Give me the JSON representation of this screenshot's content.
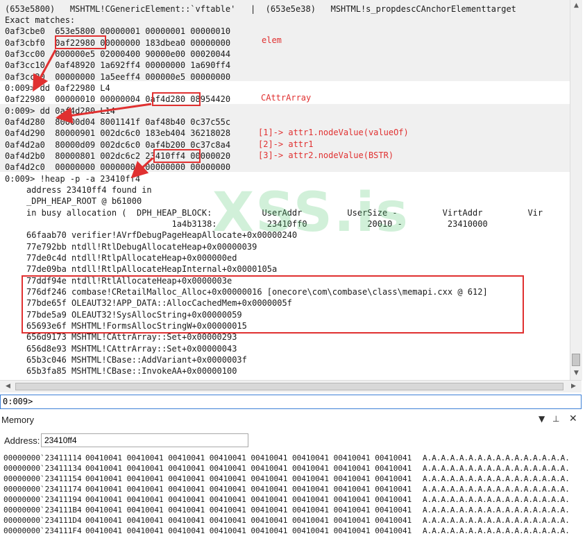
{
  "console": {
    "lines": [
      "(653e5800)   MSHTML!CGenericElement::`vftable'   |  (653e5e38)   MSHTML!s_propdescCAnchorElementtarget",
      "Exact matches:",
      "0af3cbe0  653e5800 00000001 00000001 00000010",
      "0af3cbf0  0af22980 00000000 183dbea0 00000000",
      "0af3cc00  000000e5 02000400 90000e00 00020044",
      "0af3cc10  0af48920 1a692ff4 00000000 1a690ff4",
      "0af3cc20  00000000 1a5eeff4 000000e5 00000000",
      "0:009> dd 0af22980 L4",
      "0af22980  00000010 00000004 0af4d280 08954420",
      "0:009> dd 0af4d280 L14",
      "0af4d280  80000d04 8001141f 0af48b40 0c37c55c",
      "0af4d290  80000901 002dc6c0 183eb404 36218028",
      "0af4d2a0  80000d09 002dc6c0 0af4b200 0c37c8a4",
      "0af4d2b0  80000801 002dc6c2 23410ff4 00000020",
      "0af4d2c0  00000000 00000000 00000000 00000000",
      "0:009> !heap -p -a 23410ff4",
      "address 23410ff4 found in",
      "_DPH_HEAP_ROOT @ b61000",
      "in busy allocation (  DPH_HEAP_BLOCK:          UserAddr         UserSize -         VirtAddr         Vir",
      "                             1a4b3138:          23410ff0            20010 -         23410000",
      "66faab70 verifier!AVrfDebugPageHeapAllocate+0x00000240",
      "77e792bb ntdll!RtlDebugAllocateHeap+0x00000039",
      "77de0c4d ntdll!RtlpAllocateHeap+0x000000ed",
      "77de09ba ntdll!RtlpAllocateHeapInternal+0x0000105a",
      "77ddf94e ntdll!RtlAllocateHeap+0x0000003e",
      "776df246 combase!CRetailMalloc_Alloc+0x00000016 [onecore\\com\\combase\\class\\memapi.cxx @ 612]",
      "77bde65f OLEAUT32!APP_DATA::AllocCachedMem+0x0000005f",
      "77bde5a9 OLEAUT32!SysAllocString+0x00000059",
      "65693e6f MSHTML!FormsAllocStringW+0x00000015",
      "656d9173 MSHTML!CAttrArray::Set+0x00000293",
      "656d8e93 MSHTML!CAttrArray::Set+0x00000043",
      "65b3c046 MSHTML!CBase::AddVariant+0x0000003f",
      "65b3fa85 MSHTML!CBase::InvokeAA+0x00000100"
    ],
    "prompt": "0:009>",
    "input_value": ""
  },
  "annotations": {
    "elem": "elem",
    "cattrarray": "CAttrArray",
    "attr_notes": "[1]-> attr1.nodeValue(valueOf)\n[2]-> attr1\n[3]-> attr2.nodeValue(BSTR)"
  },
  "watermark": "XSS.is",
  "memory": {
    "title": "Memory",
    "address_label": "Address:",
    "address_value": "23410ff4",
    "rows": [
      {
        "addr": "00000000`23411114",
        "hex": "00410041 00410041 00410041 00410041 00410041 00410041 00410041 00410041",
        "ascii": "A.A.A.A.A.A.A.A.A.A.A.A.A.A.A.A."
      },
      {
        "addr": "00000000`23411134",
        "hex": "00410041 00410041 00410041 00410041 00410041 00410041 00410041 00410041",
        "ascii": "A.A.A.A.A.A.A.A.A.A.A.A.A.A.A.A."
      },
      {
        "addr": "00000000`23411154",
        "hex": "00410041 00410041 00410041 00410041 00410041 00410041 00410041 00410041",
        "ascii": "A.A.A.A.A.A.A.A.A.A.A.A.A.A.A.A."
      },
      {
        "addr": "00000000`23411174",
        "hex": "00410041 00410041 00410041 00410041 00410041 00410041 00410041 00410041",
        "ascii": "A.A.A.A.A.A.A.A.A.A.A.A.A.A.A.A."
      },
      {
        "addr": "00000000`23411194",
        "hex": "00410041 00410041 00410041 00410041 00410041 00410041 00410041 00410041",
        "ascii": "A.A.A.A.A.A.A.A.A.A.A.A.A.A.A.A."
      },
      {
        "addr": "00000000`234111B4",
        "hex": "00410041 00410041 00410041 00410041 00410041 00410041 00410041 00410041",
        "ascii": "A.A.A.A.A.A.A.A.A.A.A.A.A.A.A.A."
      },
      {
        "addr": "00000000`234111D4",
        "hex": "00410041 00410041 00410041 00410041 00410041 00410041 00410041 00410041",
        "ascii": "A.A.A.A.A.A.A.A.A.A.A.A.A.A.A.A."
      },
      {
        "addr": "00000000`234111F4",
        "hex": "00410041 00410041 00410041 00410041 00410041 00410041 00410041 00410041",
        "ascii": "A.A.A.A.A.A.A.A.A.A.A.A.A.A.A.A."
      }
    ]
  },
  "colors": {
    "highlight": "#e03030",
    "accent": "#3c7fd6"
  }
}
